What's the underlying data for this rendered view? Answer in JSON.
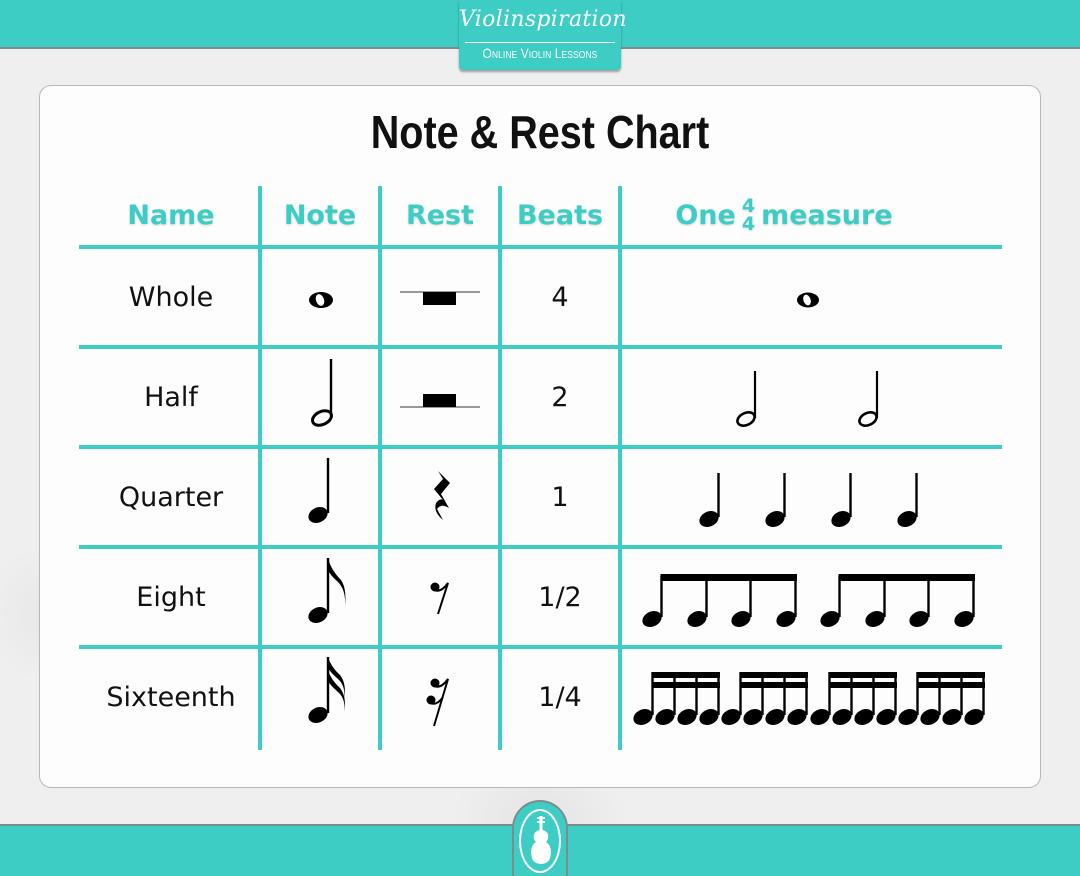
{
  "header": {
    "logo_script": "Violinspiration",
    "logo_subtitle": "Online Violin Lessons"
  },
  "title": "Note & Rest Chart",
  "table": {
    "columns": [
      "Name",
      "Note",
      "Rest",
      "Beats",
      "One",
      "measure"
    ],
    "time_signature": {
      "top": "4",
      "bottom": "4"
    },
    "rows": [
      {
        "name": "Whole",
        "note_icon": "whole-note",
        "rest_icon": "whole-rest",
        "beats": "4",
        "measure": "1 whole note"
      },
      {
        "name": "Half",
        "note_icon": "half-note",
        "rest_icon": "half-rest",
        "beats": "2",
        "measure": "2 half notes"
      },
      {
        "name": "Quarter",
        "note_icon": "quarter-note",
        "rest_icon": "quarter-rest",
        "beats": "1",
        "measure": "4 quarter notes"
      },
      {
        "name": "Eight",
        "note_icon": "eighth-note",
        "rest_icon": "eighth-rest",
        "beats": "1/2",
        "measure": "8 beamed eighth notes"
      },
      {
        "name": "Sixteenth",
        "note_icon": "sixteenth-note",
        "rest_icon": "sixteenth-rest",
        "beats": "1/4",
        "measure": "16 beamed sixteenth notes"
      }
    ]
  },
  "colors": {
    "accent": "#3ecdc4",
    "ink": "#111111",
    "card": "#fdfdfd"
  },
  "footer": {
    "emblem_icon": "violin-icon"
  }
}
